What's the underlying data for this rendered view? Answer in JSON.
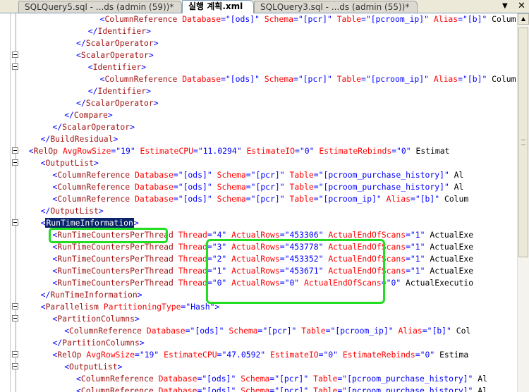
{
  "tabs": [
    {
      "label": "SQLQuery5.sql - ...ds (admin (59))*",
      "active": false
    },
    {
      "label": "실행 계획.xml",
      "active": true
    },
    {
      "label": "SQLQuery3.sql - ...ds (admin (55))*",
      "active": false
    }
  ],
  "tab_controls": {
    "dropdown": "▼",
    "close": "✕"
  },
  "scrollbar": {
    "up_arrow": "▲"
  },
  "highlight_colors": {
    "annotation_box": "#22dd22",
    "selection": "#0a246a"
  },
  "code_lines": [
    {
      "indent": 7,
      "fold": false,
      "text": "<ColumnReference Database=\"[ods]\" Schema=\"[pcr]\" Table=\"[pcroom_ip]\" Alias=\"[b]\" Colum"
    },
    {
      "indent": 6,
      "fold": false,
      "text": "</Identifier>"
    },
    {
      "indent": 5,
      "fold": false,
      "text": "</ScalarOperator>"
    },
    {
      "indent": 5,
      "fold": true,
      "text": "<ScalarOperator>"
    },
    {
      "indent": 6,
      "fold": true,
      "text": "<Identifier>"
    },
    {
      "indent": 7,
      "fold": false,
      "text": "<ColumnReference Database=\"[ods]\" Schema=\"[pcr]\" Table=\"[pcroom_ip]\" Alias=\"[b]\" Colum"
    },
    {
      "indent": 6,
      "fold": false,
      "text": "</Identifier>"
    },
    {
      "indent": 5,
      "fold": false,
      "text": "</ScalarOperator>"
    },
    {
      "indent": 4,
      "fold": false,
      "text": "</Compare>"
    },
    {
      "indent": 3,
      "fold": false,
      "text": "</ScalarOperator>"
    },
    {
      "indent": 2,
      "fold": false,
      "text": "</BuildResidual>"
    },
    {
      "indent": 1,
      "fold": true,
      "text": "<RelOp AvgRowSize=\"19\" EstimateCPU=\"11.0294\" EstimateIO=\"0\" EstimateRebinds=\"0\" Estimat"
    },
    {
      "indent": 2,
      "fold": true,
      "text": "<OutputList>"
    },
    {
      "indent": 3,
      "fold": false,
      "text": "<ColumnReference Database=\"[ods]\" Schema=\"[pcr]\" Table=\"[pcroom_purchase_history]\" Al"
    },
    {
      "indent": 3,
      "fold": false,
      "text": "<ColumnReference Database=\"[ods]\" Schema=\"[pcr]\" Table=\"[pcroom_purchase_history]\" Al"
    },
    {
      "indent": 3,
      "fold": false,
      "text": "<ColumnReference Database=\"[ods]\" Schema=\"[pcr]\" Table=\"[pcroom_ip]\" Alias=\"[b]\" Colum"
    },
    {
      "indent": 2,
      "fold": false,
      "text": "</OutputList>"
    },
    {
      "indent": 2,
      "fold": true,
      "text": "<RunTimeInformation>",
      "selected": "RunTimeInformation"
    },
    {
      "indent": 3,
      "fold": false,
      "text": "<RunTimeCountersPerThread Thread=\"4\" ActualRows=\"453306\" ActualEndOfScans=\"1\" ActualExe"
    },
    {
      "indent": 3,
      "fold": false,
      "text": "<RunTimeCountersPerThread Thread=\"3\" ActualRows=\"453778\" ActualEndOfScans=\"1\" ActualExe"
    },
    {
      "indent": 3,
      "fold": false,
      "text": "<RunTimeCountersPerThread Thread=\"2\" ActualRows=\"453352\" ActualEndOfScans=\"1\" ActualExe"
    },
    {
      "indent": 3,
      "fold": false,
      "text": "<RunTimeCountersPerThread Thread=\"1\" ActualRows=\"453671\" ActualEndOfScans=\"1\" ActualExe"
    },
    {
      "indent": 3,
      "fold": false,
      "text": "<RunTimeCountersPerThread Thread=\"0\" ActualRows=\"0\" ActualEndOfScans=\"0\" ActualExecutio"
    },
    {
      "indent": 2,
      "fold": false,
      "text": "</RunTimeInformation>"
    },
    {
      "indent": 2,
      "fold": true,
      "text": "<Parallelism PartitioningType=\"Hash\">"
    },
    {
      "indent": 3,
      "fold": true,
      "text": "<PartitionColumns>"
    },
    {
      "indent": 4,
      "fold": false,
      "text": "<ColumnReference Database=\"[ods]\" Schema=\"[pcr]\" Table=\"[pcroom_ip]\" Alias=\"[b]\" Col"
    },
    {
      "indent": 3,
      "fold": false,
      "text": "</PartitionColumns>"
    },
    {
      "indent": 3,
      "fold": true,
      "text": "<RelOp AvgRowSize=\"19\" EstimateCPU=\"47.0592\" EstimateIO=\"0\" EstimateRebinds=\"0\" Estima"
    },
    {
      "indent": 4,
      "fold": true,
      "text": "<OutputList>"
    },
    {
      "indent": 5,
      "fold": false,
      "text": "<ColumnReference Database=\"[ods]\" Schema=\"[pcr]\" Table=\"[pcroom_purchase_history]\" Al"
    },
    {
      "indent": 5,
      "fold": false,
      "text": "<ColumnReference Database=\"[ods]\" Schema=\"[pcr]\" Table=\"[pcroom_purchase_history]\" Al"
    }
  ]
}
